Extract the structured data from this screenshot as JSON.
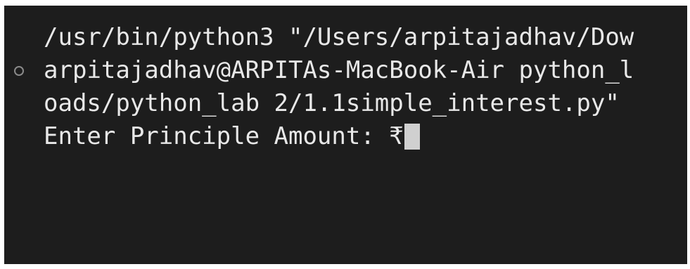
{
  "terminal": {
    "lines": {
      "command": "/usr/bin/python3 \"/Users/arpitajadhav/Dow",
      "prompt": "arpitajadhav@ARPITAs-MacBook-Air python_l",
      "path_continuation": "oads/python_lab 2/1.1simple_interest.py\"",
      "input_prompt": "Enter Principle Amount: ₹"
    },
    "status_indicator": "circle-icon",
    "colors": {
      "background": "#1d1d1d",
      "text": "#e8e8e8",
      "cursor": "#d0d0d0",
      "status_dot": "#8a8a8a"
    }
  }
}
